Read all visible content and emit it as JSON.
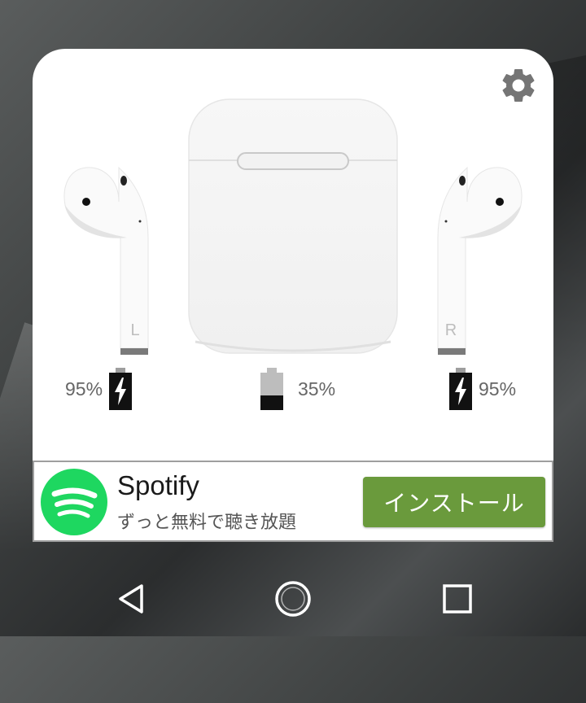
{
  "earbuds": {
    "left": {
      "side_label": "L",
      "battery_percent": "95%",
      "battery_level": 0.95,
      "charging": true,
      "battery_icon": "battery-charging-icon"
    },
    "case": {
      "battery_percent": "35%",
      "battery_level": 0.35,
      "charging": false,
      "battery_icon": "battery-icon"
    },
    "right": {
      "side_label": "R",
      "battery_percent": "95%",
      "battery_level": 0.95,
      "charging": true,
      "battery_icon": "battery-charging-icon"
    }
  },
  "settings": {
    "icon": "gear-icon"
  },
  "ad": {
    "title": "Spotify",
    "subtitle": "ずっと無料で聴き放題",
    "install_label": "インストール",
    "logo_icon": "spotify-logo",
    "button_color": "#6a9a3c"
  },
  "navbar": {
    "back_icon": "back-triangle-icon",
    "home_icon": "home-circle-icon",
    "recents_icon": "recents-square-icon"
  }
}
